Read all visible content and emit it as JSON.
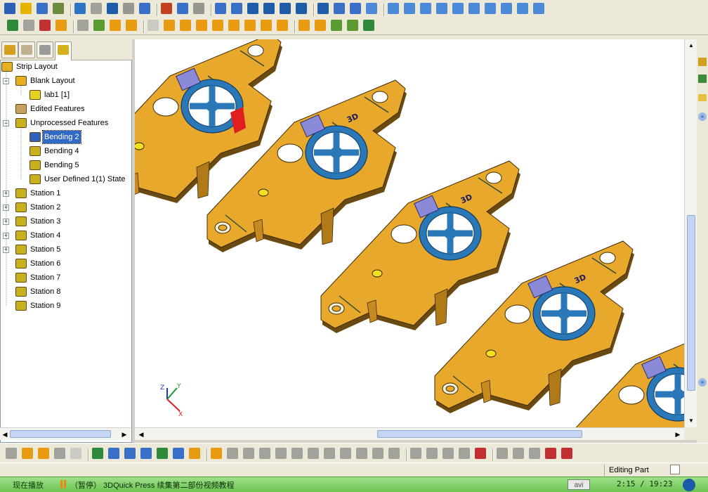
{
  "toolbar": {
    "row1_colors": [
      "#2b5fb3",
      "#e6b400",
      "#3a6fc8",
      "#6e8a3d",
      "#2e74c4",
      "#888888",
      "#1f5ca8",
      "#7a7a7a",
      "#3a6fc8",
      "#c04020",
      "#3a6fc8",
      "#7a7a7a",
      "#3a6fc8",
      "#3a6fc8",
      "#1f5ca8",
      "#1f5ca8",
      "#1f5ca8",
      "#1f5ca8",
      "#1f5ca8",
      "#3a6fc8",
      "#3a6fc8",
      "#4a8ad8",
      "#4a8ad8",
      "#4a8ad8",
      "#4a8ad8",
      "#4a8ad8",
      "#4a8ad8",
      "#4a8ad8",
      "#4a8ad8",
      "#4a8ad8",
      "#4a8ad8",
      "#4a8ad8"
    ],
    "row2_colors": [
      "#2e8a3a",
      "#8a8a8a",
      "#c03030",
      "#e89a10",
      "#8a8a8a",
      "#5a9a30",
      "#e89a10",
      "#e89a10",
      "#bfbfbf",
      "#e89a10",
      "#e89a10",
      "#e89a10",
      "#e89a10",
      "#e89a10",
      "#e89a10",
      "#e89a10",
      "#e89a10",
      "#e89a10",
      "#e89a10",
      "#5a9a30",
      "#5a9a30",
      "#2e8a3a"
    ],
    "bottom_colors": [
      "#8a8a8a",
      "#e89a10",
      "#e89a10",
      "#8a8a8a",
      "#bfbfbf",
      "#2e8a3a",
      "#3a6fc8",
      "#3a6fc8",
      "#3a6fc8",
      "#2e8a3a",
      "#3a6fc8",
      "#e89a10",
      "#e89a10",
      "#8a8a8a",
      "#8a8a8a",
      "#8a8a8a",
      "#8a8a8a",
      "#8a8a8a",
      "#8a8a8a",
      "#8a8a8a",
      "#8a8a8a",
      "#8a8a8a",
      "#8a8a8a",
      "#8a8a8a",
      "#8a8a8a",
      "#8a8a8a",
      "#8a8a8a",
      "#8a8a8a",
      "#c03030",
      "#8a8a8a",
      "#8a8a8a",
      "#8a8a8a",
      "#c03030",
      "#c03030"
    ]
  },
  "tree": {
    "tabs": [
      "tree-tab-1",
      "tree-tab-2",
      "tree-tab-3",
      "tree-tab-4"
    ],
    "nodes": [
      {
        "label": "Strip Layout",
        "level": 0,
        "expander": "",
        "icon": "strip-layout-icon",
        "color": "#e8b020"
      },
      {
        "label": "Blank Layout",
        "level": 1,
        "expander": "−",
        "icon": "blank-layout-icon",
        "color": "#e8b020"
      },
      {
        "label": "lab1 [1]",
        "level": 2,
        "expander": "",
        "icon": "blank-part-icon",
        "color": "#e8d020"
      },
      {
        "label": "Edited Features",
        "level": 1,
        "expander": "",
        "icon": "edited-features-icon",
        "color": "#c8a060"
      },
      {
        "label": "Unprocessed Features",
        "level": 1,
        "expander": "−",
        "icon": "unprocessed-features-icon",
        "color": "#c8b020"
      },
      {
        "label": "Bending 2",
        "level": 2,
        "expander": "",
        "icon": "bending-icon",
        "color": "#3060c0",
        "selected": true
      },
      {
        "label": "Bending 4",
        "level": 2,
        "expander": "",
        "icon": "bending-icon",
        "color": "#c8b020"
      },
      {
        "label": "Bending 5",
        "level": 2,
        "expander": "",
        "icon": "bending-icon",
        "color": "#c8b020"
      },
      {
        "label": "User Defined 1(1) State",
        "level": 2,
        "expander": "",
        "icon": "user-defined-icon",
        "color": "#c8b020"
      },
      {
        "label": "Station 1",
        "level": 1,
        "expander": "+",
        "icon": "station-icon",
        "color": "#c8b020"
      },
      {
        "label": "Station 2",
        "level": 1,
        "expander": "+",
        "icon": "station-icon",
        "color": "#c8b020"
      },
      {
        "label": "Station 3",
        "level": 1,
        "expander": "+",
        "icon": "station-icon",
        "color": "#c8b020"
      },
      {
        "label": "Station 4",
        "level": 1,
        "expander": "+",
        "icon": "station-icon",
        "color": "#c8b020"
      },
      {
        "label": "Station 5",
        "level": 1,
        "expander": "+",
        "icon": "station-icon",
        "color": "#c8b020"
      },
      {
        "label": "Station 6",
        "level": 1,
        "expander": "",
        "icon": "station-icon",
        "color": "#c8b020"
      },
      {
        "label": "Station 7",
        "level": 1,
        "expander": "",
        "icon": "station-icon",
        "color": "#c8b020"
      },
      {
        "label": "Station 8",
        "level": 1,
        "expander": "",
        "icon": "station-icon",
        "color": "#c8b020"
      },
      {
        "label": "Station 9",
        "level": 1,
        "expander": "",
        "icon": "station-icon",
        "color": "#c8b020"
      }
    ]
  },
  "viewport": {
    "part_color": "#e8a82c",
    "part_edge": "#6a4a10",
    "hole_color": "#2a78b8",
    "badge_text": "3D",
    "axis_labels": {
      "x": "X",
      "y": "Y",
      "z": "Z"
    }
  },
  "status": {
    "mode": "Editing Part"
  },
  "taskbar": {
    "now_playing": "现在播放",
    "track": "（暂停） 3DQuick Press 续集第二部份视频教程",
    "format": "avi",
    "time": "2:15 / 19:23"
  }
}
